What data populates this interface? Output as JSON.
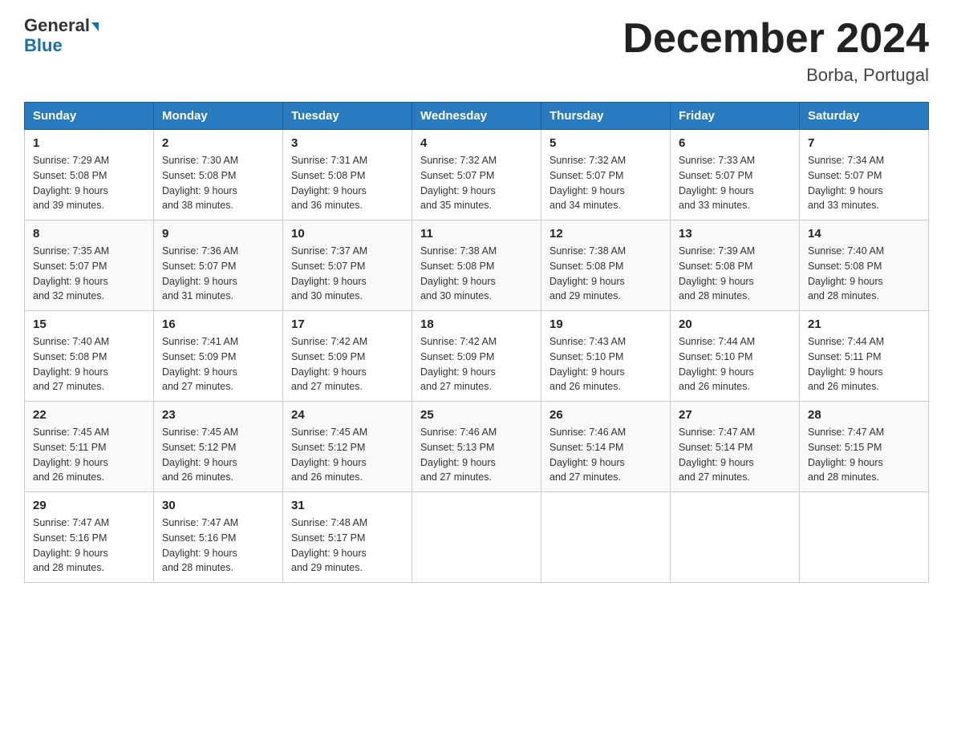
{
  "header": {
    "logo_line1": "General",
    "logo_line2": "Blue",
    "month_title": "December 2024",
    "location": "Borba, Portugal"
  },
  "days_of_week": [
    "Sunday",
    "Monday",
    "Tuesday",
    "Wednesday",
    "Thursday",
    "Friday",
    "Saturday"
  ],
  "weeks": [
    [
      {
        "day": "1",
        "sunrise": "7:29 AM",
        "sunset": "5:08 PM",
        "daylight": "9 hours and 39 minutes."
      },
      {
        "day": "2",
        "sunrise": "7:30 AM",
        "sunset": "5:08 PM",
        "daylight": "9 hours and 38 minutes."
      },
      {
        "day": "3",
        "sunrise": "7:31 AM",
        "sunset": "5:08 PM",
        "daylight": "9 hours and 36 minutes."
      },
      {
        "day": "4",
        "sunrise": "7:32 AM",
        "sunset": "5:07 PM",
        "daylight": "9 hours and 35 minutes."
      },
      {
        "day": "5",
        "sunrise": "7:32 AM",
        "sunset": "5:07 PM",
        "daylight": "9 hours and 34 minutes."
      },
      {
        "day": "6",
        "sunrise": "7:33 AM",
        "sunset": "5:07 PM",
        "daylight": "9 hours and 33 minutes."
      },
      {
        "day": "7",
        "sunrise": "7:34 AM",
        "sunset": "5:07 PM",
        "daylight": "9 hours and 33 minutes."
      }
    ],
    [
      {
        "day": "8",
        "sunrise": "7:35 AM",
        "sunset": "5:07 PM",
        "daylight": "9 hours and 32 minutes."
      },
      {
        "day": "9",
        "sunrise": "7:36 AM",
        "sunset": "5:07 PM",
        "daylight": "9 hours and 31 minutes."
      },
      {
        "day": "10",
        "sunrise": "7:37 AM",
        "sunset": "5:07 PM",
        "daylight": "9 hours and 30 minutes."
      },
      {
        "day": "11",
        "sunrise": "7:38 AM",
        "sunset": "5:08 PM",
        "daylight": "9 hours and 30 minutes."
      },
      {
        "day": "12",
        "sunrise": "7:38 AM",
        "sunset": "5:08 PM",
        "daylight": "9 hours and 29 minutes."
      },
      {
        "day": "13",
        "sunrise": "7:39 AM",
        "sunset": "5:08 PM",
        "daylight": "9 hours and 28 minutes."
      },
      {
        "day": "14",
        "sunrise": "7:40 AM",
        "sunset": "5:08 PM",
        "daylight": "9 hours and 28 minutes."
      }
    ],
    [
      {
        "day": "15",
        "sunrise": "7:40 AM",
        "sunset": "5:08 PM",
        "daylight": "9 hours and 27 minutes."
      },
      {
        "day": "16",
        "sunrise": "7:41 AM",
        "sunset": "5:09 PM",
        "daylight": "9 hours and 27 minutes."
      },
      {
        "day": "17",
        "sunrise": "7:42 AM",
        "sunset": "5:09 PM",
        "daylight": "9 hours and 27 minutes."
      },
      {
        "day": "18",
        "sunrise": "7:42 AM",
        "sunset": "5:09 PM",
        "daylight": "9 hours and 27 minutes."
      },
      {
        "day": "19",
        "sunrise": "7:43 AM",
        "sunset": "5:10 PM",
        "daylight": "9 hours and 26 minutes."
      },
      {
        "day": "20",
        "sunrise": "7:44 AM",
        "sunset": "5:10 PM",
        "daylight": "9 hours and 26 minutes."
      },
      {
        "day": "21",
        "sunrise": "7:44 AM",
        "sunset": "5:11 PM",
        "daylight": "9 hours and 26 minutes."
      }
    ],
    [
      {
        "day": "22",
        "sunrise": "7:45 AM",
        "sunset": "5:11 PM",
        "daylight": "9 hours and 26 minutes."
      },
      {
        "day": "23",
        "sunrise": "7:45 AM",
        "sunset": "5:12 PM",
        "daylight": "9 hours and 26 minutes."
      },
      {
        "day": "24",
        "sunrise": "7:45 AM",
        "sunset": "5:12 PM",
        "daylight": "9 hours and 26 minutes."
      },
      {
        "day": "25",
        "sunrise": "7:46 AM",
        "sunset": "5:13 PM",
        "daylight": "9 hours and 27 minutes."
      },
      {
        "day": "26",
        "sunrise": "7:46 AM",
        "sunset": "5:14 PM",
        "daylight": "9 hours and 27 minutes."
      },
      {
        "day": "27",
        "sunrise": "7:47 AM",
        "sunset": "5:14 PM",
        "daylight": "9 hours and 27 minutes."
      },
      {
        "day": "28",
        "sunrise": "7:47 AM",
        "sunset": "5:15 PM",
        "daylight": "9 hours and 28 minutes."
      }
    ],
    [
      {
        "day": "29",
        "sunrise": "7:47 AM",
        "sunset": "5:16 PM",
        "daylight": "9 hours and 28 minutes."
      },
      {
        "day": "30",
        "sunrise": "7:47 AM",
        "sunset": "5:16 PM",
        "daylight": "9 hours and 28 minutes."
      },
      {
        "day": "31",
        "sunrise": "7:48 AM",
        "sunset": "5:17 PM",
        "daylight": "9 hours and 29 minutes."
      },
      null,
      null,
      null,
      null
    ]
  ],
  "labels": {
    "sunrise": "Sunrise:",
    "sunset": "Sunset:",
    "daylight": "Daylight:"
  }
}
